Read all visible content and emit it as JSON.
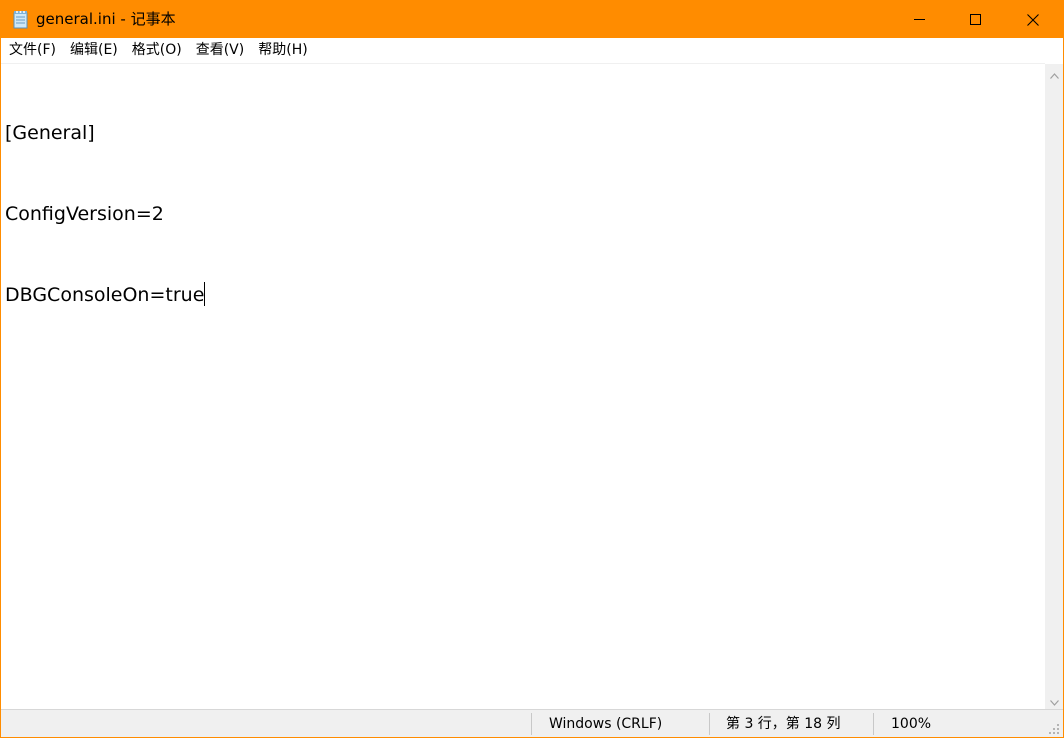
{
  "window": {
    "title": "general.ini - 记事本",
    "accent_color": "#ff8c00",
    "icon": "notepad-icon"
  },
  "controls": {
    "minimize_icon": "minimize-icon",
    "maximize_icon": "maximize-icon",
    "close_icon": "close-icon"
  },
  "menu": {
    "items": [
      {
        "label": "文件(F)"
      },
      {
        "label": "编辑(E)"
      },
      {
        "label": "格式(O)"
      },
      {
        "label": "查看(V)"
      },
      {
        "label": "帮助(H)"
      }
    ]
  },
  "document": {
    "lines": [
      "[General]",
      "ConfigVersion=2",
      "DBGConsoleOn=true"
    ]
  },
  "status": {
    "encoding": "Windows (CRLF)",
    "position": "第 3 行，第 18 列",
    "zoom": "100%"
  }
}
